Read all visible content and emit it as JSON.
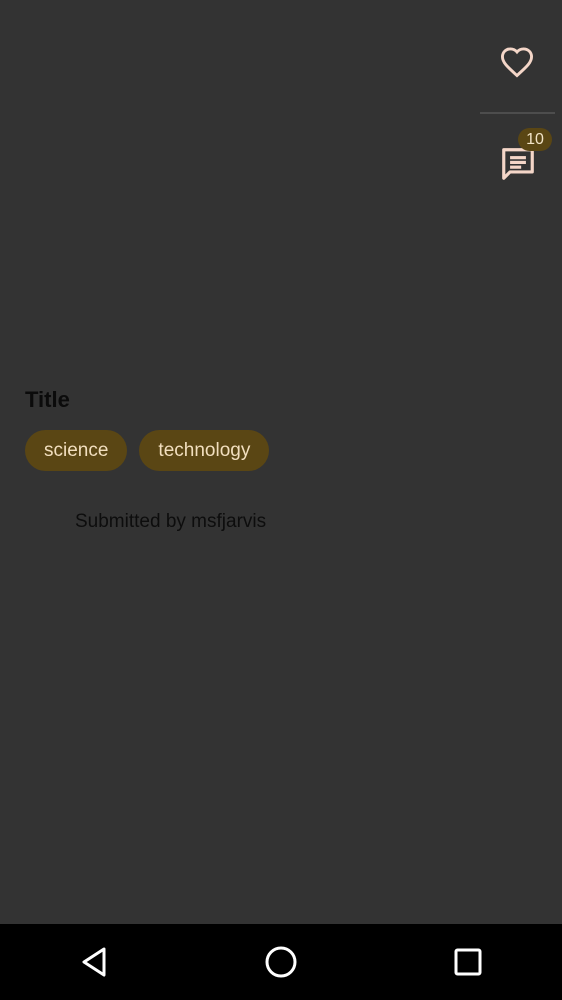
{
  "post": {
    "title": "Title",
    "tags": [
      "science",
      "technology"
    ],
    "submitted_text": "Submitted by msfjarvis",
    "comment_count": "10"
  },
  "actions": {
    "favorite_icon": "heart-outline-icon",
    "comments_icon": "comment-icon"
  },
  "navigation": {
    "back_icon": "back-triangle-icon",
    "home_icon": "home-circle-icon",
    "recents_icon": "recents-square-icon"
  },
  "colors": {
    "background": "#333333",
    "accent_chip": "#5a4614",
    "chip_text": "#f2dfbf",
    "icon_tint": "#f4d6c8",
    "nav_bar": "#000000"
  }
}
